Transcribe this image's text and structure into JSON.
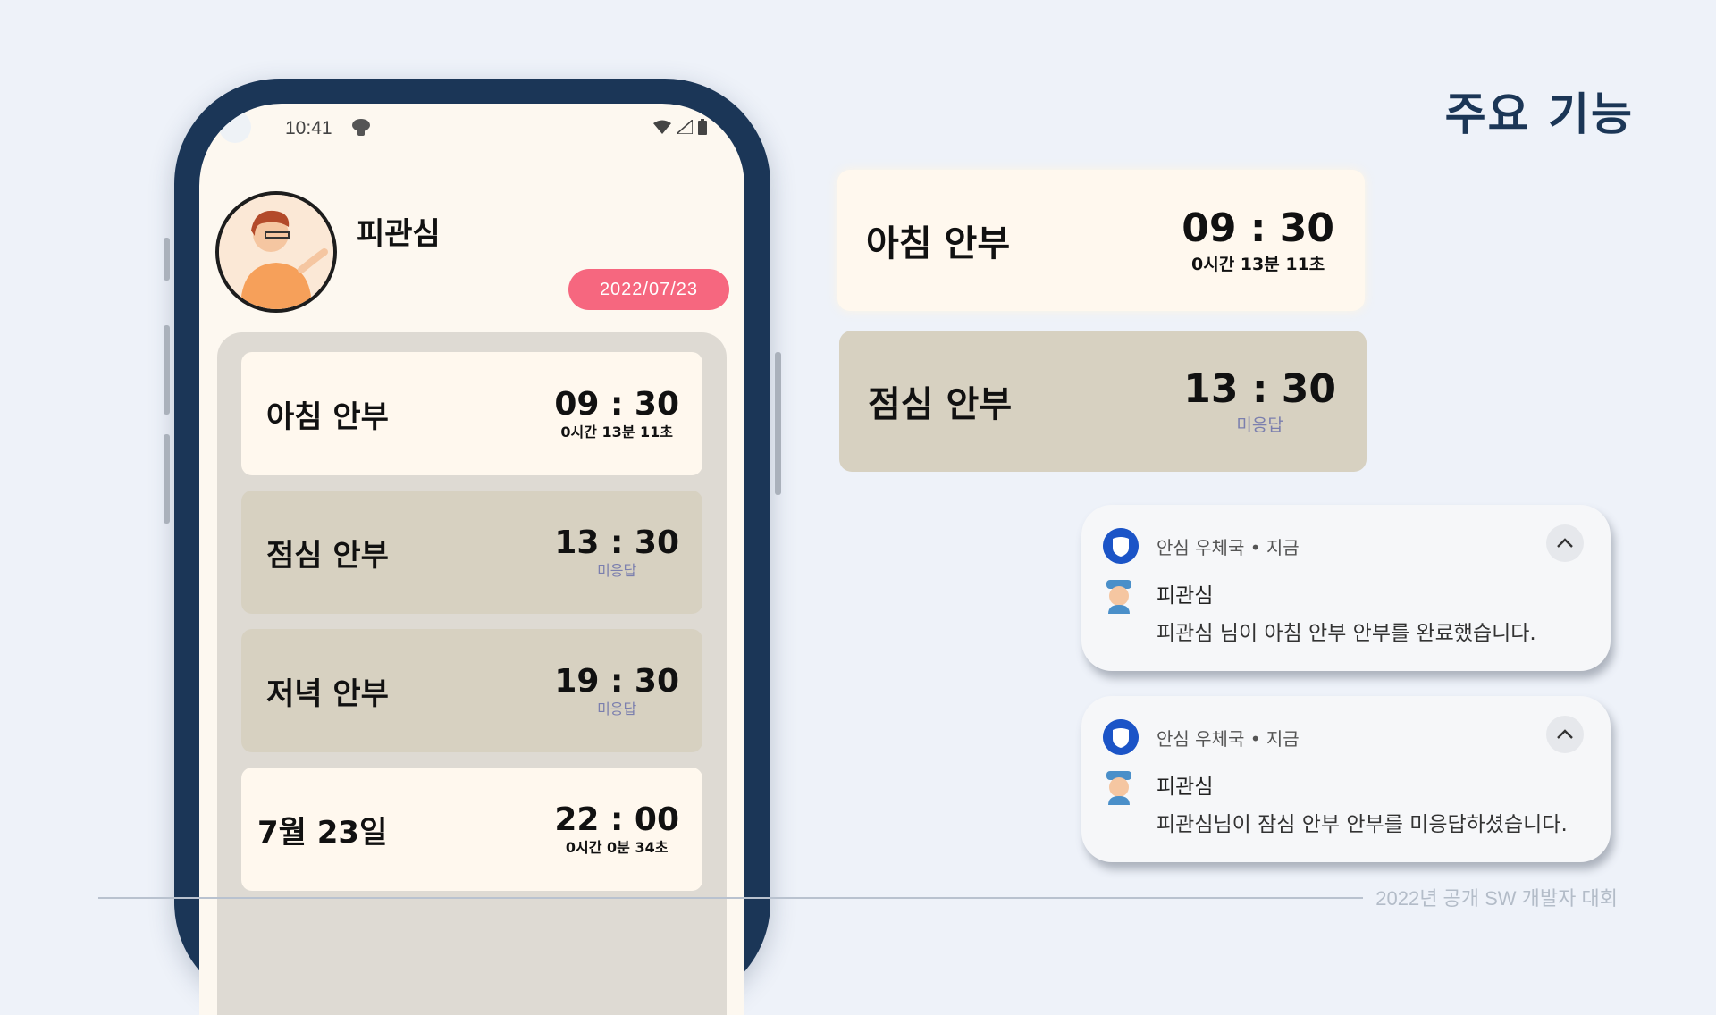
{
  "slide": {
    "title": "주요 기능",
    "footer": "2022년 공개 SW 개발자 대회"
  },
  "phone": {
    "status_time": "10:41",
    "user_name": "피관심",
    "date": "2022/07/23",
    "items": [
      {
        "label": "아침 안부",
        "time": "09 : 30",
        "sub": "0시간 13분 11초",
        "state": "done"
      },
      {
        "label": "점심 안부",
        "time": "13 : 30",
        "sub": "미응답",
        "state": "missed"
      },
      {
        "label": "저녁 안부",
        "time": "19 : 30",
        "sub": "미응답",
        "state": "missed"
      },
      {
        "label": "7월 23일",
        "time": "22 : 00",
        "sub": "0시간 0분 34초",
        "state": "done"
      }
    ]
  },
  "cards": [
    {
      "label": "아침 안부",
      "time": "09 : 30",
      "sub": "0시간 13분 11초"
    },
    {
      "label": "점심 안부",
      "time": "13 : 30",
      "sub": "미응답"
    }
  ],
  "notifications": [
    {
      "app": "안심 우체국",
      "when": "지금",
      "meta": "안심 우체국 • 지금",
      "title": "피관심",
      "body": "피관심 님이 아침 안부 안부를 완료했습니다."
    },
    {
      "app": "안심 우체국",
      "when": "지금",
      "meta": "안심 우체국 • 지금",
      "title": "피관심",
      "body": "피관심님이 잠심 안부 안부를 미응답하셨습니다."
    }
  ],
  "colors": {
    "background": "#eef2f9",
    "phone_frame": "#1b3657",
    "date_pill": "#f6677f",
    "card_done": "#fff8ee",
    "card_missed": "#d7d1c1",
    "missed_text": "#7b7fae",
    "app_icon": "#1b54c7"
  },
  "icons": {
    "status": [
      "mascot-icon",
      "wifi-icon",
      "signal-icon",
      "battery-icon"
    ],
    "notification_app": "shield-icon",
    "notification_sender": "mailman-icon",
    "collapse": "chevron-up-icon"
  }
}
